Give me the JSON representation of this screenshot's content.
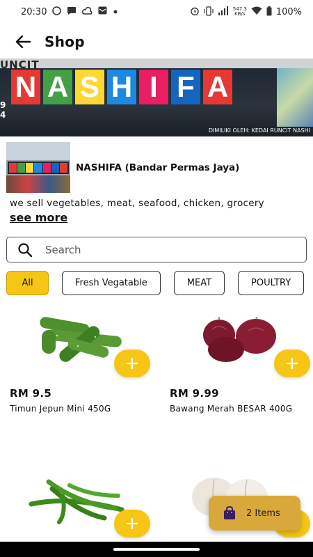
{
  "status_bar": {
    "time": "20:30",
    "battery": "100%",
    "net_speed_top": "547.3",
    "net_speed_bottom": "KB/s",
    "icons": [
      "whatsapp-icon",
      "chat-icon",
      "cloud-icon",
      "mail-icon",
      "alarm-icon",
      "vibrate-icon",
      "signal-icon",
      "wifi-icon",
      "battery-icon"
    ]
  },
  "app_bar": {
    "title": "Shop"
  },
  "banner": {
    "top_text": "UNCIT",
    "letters": [
      "N",
      "A",
      "S",
      "H",
      "I",
      "F",
      "A"
    ],
    "letter_colors": [
      "#e53935",
      "#43a047",
      "#fdd835",
      "#1e88e5",
      "#e91e63",
      "#1565c0",
      "#e53935"
    ],
    "left_digits": [
      "9",
      "4"
    ],
    "owner_text": "DIMILIKI OLEH: KEDAI RUNCIT NASHI"
  },
  "shop": {
    "name": "NASHIFA (Bandar Permas Jaya)",
    "description": "we sell vegetables, meat, seafood, chicken, grocery",
    "see_more": "see more"
  },
  "search": {
    "placeholder": "Search"
  },
  "categories": [
    {
      "label": "All",
      "active": true
    },
    {
      "label": "Fresh Vegatable",
      "active": false
    },
    {
      "label": "MEAT",
      "active": false
    },
    {
      "label": "POULTRY",
      "active": false
    }
  ],
  "products": [
    {
      "price": "RM 9.5",
      "name": "Timun Jepun Mini 450G",
      "image": "cucumber"
    },
    {
      "price": "RM 9.99",
      "name": "Bawang Merah BESAR 400G",
      "image": "red-onion"
    },
    {
      "price": "",
      "name": "",
      "image": "green-chili"
    },
    {
      "price": "",
      "name": "",
      "image": "garlic"
    }
  ],
  "cart": {
    "label": "2 Items"
  },
  "colors": {
    "accent": "#f6c516",
    "cart": "#d9a83a",
    "cart_icon": "#3b1a66"
  }
}
